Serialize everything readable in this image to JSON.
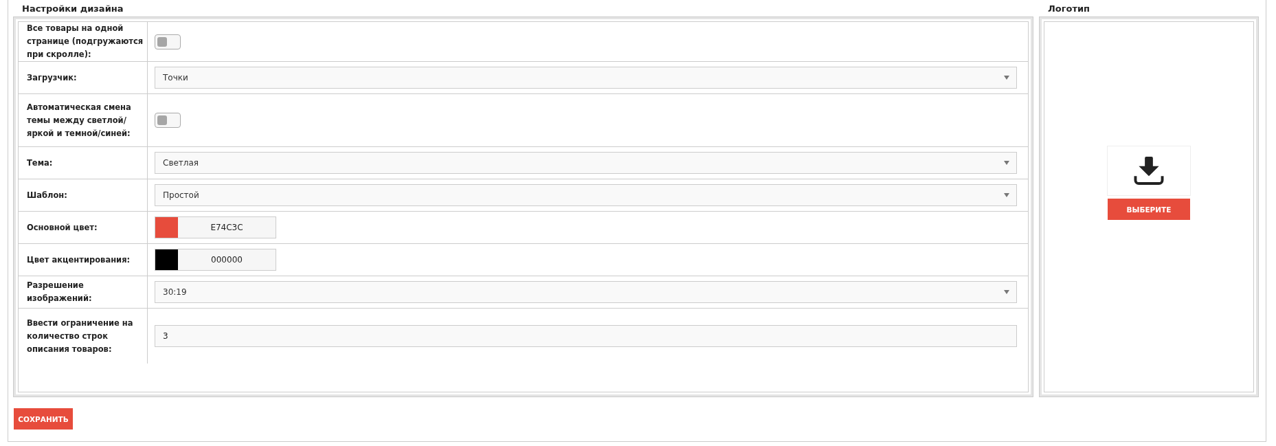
{
  "design": {
    "title": "Настройки дизайна",
    "settings": [
      {
        "kind": "toggle",
        "label": "Все товары на одной странице (подгружаются при скролле):",
        "on": false
      },
      {
        "kind": "select",
        "label": "Загрузчик:",
        "value": "Точки"
      },
      {
        "kind": "toggle",
        "label": "Автоматическая смена темы между светлой/яркой и темной/синей:",
        "on": false
      },
      {
        "kind": "select",
        "label": "Тема:",
        "value": "Светлая"
      },
      {
        "kind": "select",
        "label": "Шаблон:",
        "value": "Простой"
      },
      {
        "kind": "color",
        "label": "Основной цвет:",
        "value": "E74C3C",
        "color": "#e74c3c"
      },
      {
        "kind": "color",
        "label": "Цвет акцентирования:",
        "value": "000000",
        "color": "#000000"
      },
      {
        "kind": "select",
        "label": "Разрешение изображений:",
        "value": "30:19"
      },
      {
        "kind": "input",
        "label": "Ввести ограничение на количество строк описания товаров:",
        "value": "3"
      }
    ]
  },
  "logo": {
    "title": "Логотип",
    "button": "ВЫБЕРИТЕ"
  },
  "save_button": "СОХРАНИТЬ"
}
